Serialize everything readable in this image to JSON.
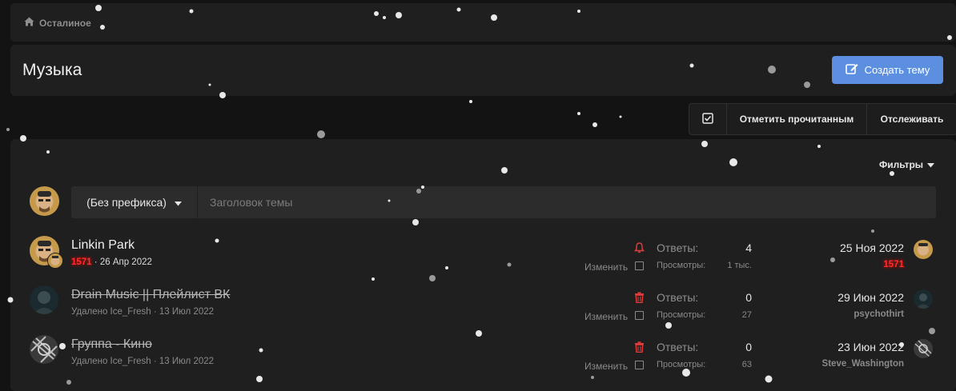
{
  "breadcrumb": {
    "label": "Осталиное"
  },
  "header": {
    "title": "Музыка",
    "create_label": "Создать тему"
  },
  "actions": {
    "mark_read": "Отметить прочитанным",
    "watch": "Отслеживать"
  },
  "filters": {
    "label": "Фильтры"
  },
  "quick_thread": {
    "prefix": "(Без префикса)",
    "placeholder": "Заголовок темы"
  },
  "threads": [
    {
      "title": "Linkin Park",
      "author": "1571",
      "date": "26 Апр 2022",
      "edit": "Изменить",
      "replies_label": "Ответы:",
      "replies": "4",
      "views_label": "Просмотры:",
      "views": "1 тыс.",
      "last_date": "25 Ноя 2022",
      "last_user": "1571"
    },
    {
      "title": "Drain Music || Плейлист ВК",
      "meta": "Удалено Ice_Fresh · 13 Июл 2022",
      "edit": "Изменить",
      "replies_label": "Ответы:",
      "replies": "0",
      "views_label": "Просмотры:",
      "views": "27",
      "last_date": "29 Июн 2022",
      "last_user": "psychothirt"
    },
    {
      "title": "Группа - Кино",
      "meta": "Удалено Ice_Fresh · 13 Июл 2022",
      "edit": "Изменить",
      "replies_label": "Ответы:",
      "replies": "0",
      "views_label": "Просмотры:",
      "views": "63",
      "last_date": "23 Июн 2022",
      "last_user": "Steve_Washington"
    }
  ],
  "colors": {
    "accent": "#5c8fe0",
    "reputation": "#ff2d2d",
    "panel": "#1f1f1f",
    "background": "#131313"
  }
}
